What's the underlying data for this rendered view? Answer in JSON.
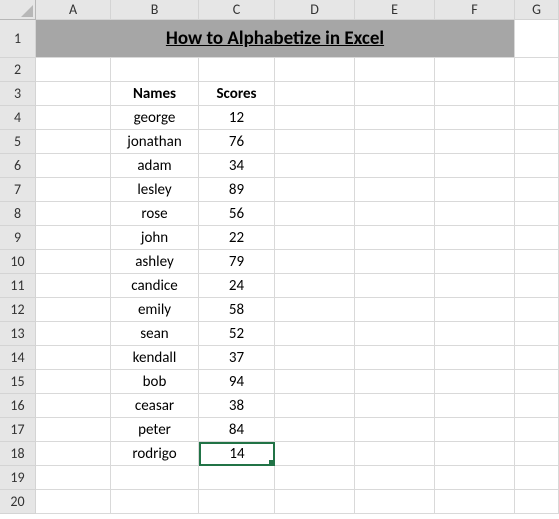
{
  "columns": [
    "A",
    "B",
    "C",
    "D",
    "E",
    "F",
    "G"
  ],
  "row_count": 20,
  "title": "How to Alphabetize in Excel",
  "headers": {
    "names": "Names",
    "scores": "Scores"
  },
  "rows": [
    {
      "name": "george",
      "score": "12"
    },
    {
      "name": "jonathan",
      "score": "76"
    },
    {
      "name": "adam",
      "score": "34"
    },
    {
      "name": "lesley",
      "score": "89"
    },
    {
      "name": "rose",
      "score": "56"
    },
    {
      "name": "john",
      "score": "22"
    },
    {
      "name": "ashley",
      "score": "79"
    },
    {
      "name": "candice",
      "score": "24"
    },
    {
      "name": "emily",
      "score": "58"
    },
    {
      "name": "sean",
      "score": "52"
    },
    {
      "name": "kendall",
      "score": "37"
    },
    {
      "name": "bob",
      "score": "94"
    },
    {
      "name": "ceasar",
      "score": "38"
    },
    {
      "name": "peter",
      "score": "84"
    },
    {
      "name": "rodrigo",
      "score": "14"
    }
  ],
  "active_cell": "C18",
  "active_value": "14",
  "chart_data": {
    "type": "table",
    "title": "How to Alphabetize in Excel",
    "columns": [
      "Names",
      "Scores"
    ],
    "records": [
      [
        "george",
        12
      ],
      [
        "jonathan",
        76
      ],
      [
        "adam",
        34
      ],
      [
        "lesley",
        89
      ],
      [
        "rose",
        56
      ],
      [
        "john",
        22
      ],
      [
        "ashley",
        79
      ],
      [
        "candice",
        24
      ],
      [
        "emily",
        58
      ],
      [
        "sean",
        52
      ],
      [
        "kendall",
        37
      ],
      [
        "bob",
        94
      ],
      [
        "ceasar",
        38
      ],
      [
        "peter",
        84
      ],
      [
        "rodrigo",
        14
      ]
    ]
  }
}
